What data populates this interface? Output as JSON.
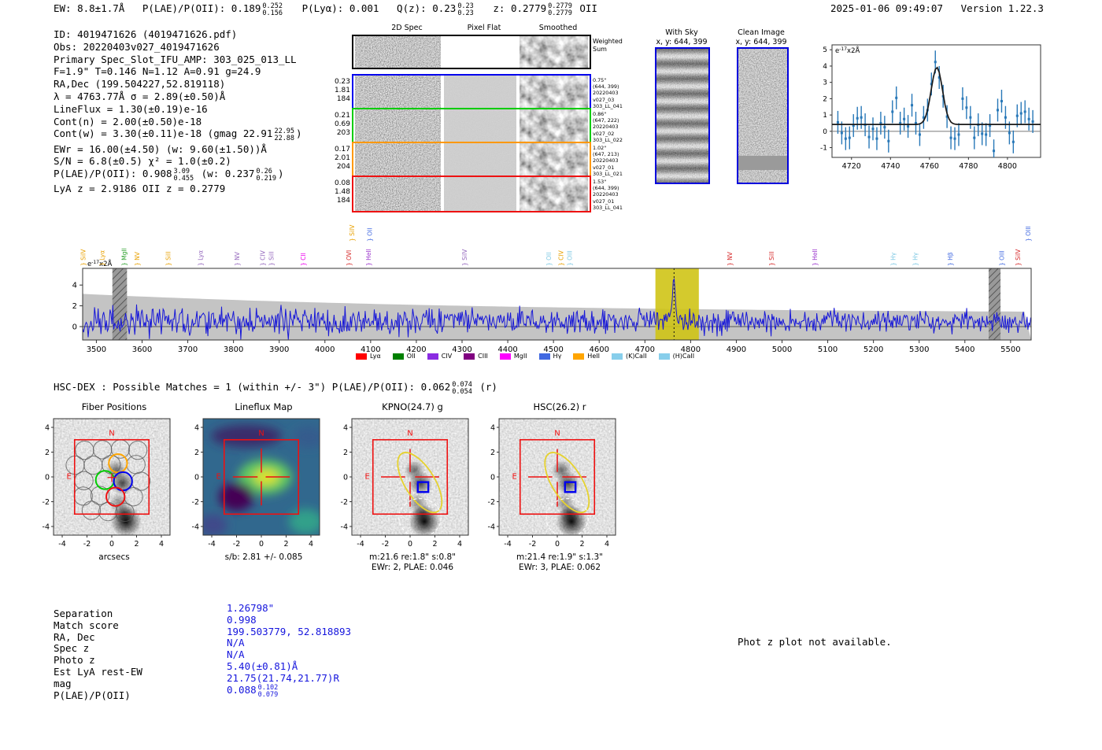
{
  "header": {
    "ew": "EW: 8.8±1.7Å",
    "plae_label": "P(LAE)/P(OII): 0.189",
    "plae_hi": "0.252",
    "plae_lo": "0.156",
    "plya": "P(Lyα): 0.001",
    "qz_label": "Q(z): 0.23",
    "qz_hi": "0.23",
    "qz_lo": "0.23",
    "z_label": "z: 0.2779",
    "z_hi": "0.2779",
    "z_lo": "0.2779",
    "z_suffix": "OII",
    "datetime": "2025-01-06 09:49:07",
    "version": "Version 1.22.3"
  },
  "info": {
    "id": "ID: 4019471626 (4019471626.pdf)",
    "obs": "Obs: 20220403v027_4019471626",
    "slot": "Primary Spec_Slot_IFU_AMP: 303_025_013_LL",
    "seeing": "F=1.9\"  T=0.146  N=1.12  A=0.91  g=24.9",
    "radec": "RA,Dec (199.504227,52.819118)",
    "lambda": "λ = 4763.77Å  σ = 2.89(±0.50)Å",
    "lineflux": "LineFlux = 1.30(±0.19)e-16",
    "cont_n": "Cont(n) = 2.00(±0.50)e-18",
    "cont_w_pre": "Cont(w) = 3.30(±0.11)e-18 (gmag 22.91",
    "cont_w_hi": "22.95",
    "cont_w_lo": "22.88",
    "cont_w_post": ")",
    "ewr": "EWr = 16.00(±4.50) (w: 9.60(±1.50))Å",
    "sn": "S/N = 6.8(±0.5)  χ² = 1.0(±0.2)",
    "plae_pre": "P(LAE)/P(OII): 0.908",
    "plae_hi": "3.09",
    "plae_lo": "0.455",
    "plae_mid": "(w: 0.237",
    "plae_whi": "0.26",
    "plae_wlo": "0.219",
    "plae_post": ")",
    "zline": "LyA z = 2.9186  OII z = 0.2779"
  },
  "spec2d": {
    "col_headers": [
      "2D Spec",
      "Pixel Flat",
      "Smoothed"
    ],
    "rows": [
      {
        "border": "#000000",
        "left": [],
        "right": [
          "Weighted",
          "Sum"
        ],
        "right_big": true
      },
      {
        "border": "#0000ee",
        "left": [
          "0.23",
          "1.81",
          "184"
        ],
        "right": [
          "0.75\"",
          "(644, 399)",
          "20220403",
          "v027_03",
          "303_LL_041"
        ]
      },
      {
        "border": "#00cc00",
        "left": [
          "0.21",
          "0.69",
          "203"
        ],
        "right": [
          "0.86\"",
          "(647, 222)",
          "20220403",
          "v027_02",
          "303_LL_022"
        ]
      },
      {
        "border": "#ff9800",
        "left": [
          "0.17",
          "2.01",
          "204"
        ],
        "right": [
          "1.02\"",
          "(647, 213)",
          "20220403",
          "v027_01",
          "303_LL_021"
        ]
      },
      {
        "border": "#ee1111",
        "left": [
          "0.08",
          "1.48",
          "184"
        ],
        "right": [
          "1.53\"",
          "(644, 399)",
          "20220403",
          "v027_01",
          "303_LL_041"
        ]
      }
    ]
  },
  "stamps": {
    "with_sky_title": "With Sky",
    "with_sky_sub": "x, y: 644, 399",
    "clean_title": "Clean Image",
    "clean_sub": "x, y: 644, 399"
  },
  "hscdex": {
    "pre": "HSC-DEX : Possible Matches = 1 (within +/- 3\")  P(LAE)/P(OII): 0.062",
    "hi": "0.074",
    "lo": "0.054",
    "post": " (r)"
  },
  "chart_data": [
    {
      "type": "scatter",
      "name": "emission-line-fit",
      "units": {
        "base": "e",
        "exp": "-17",
        "rest": "x2Å"
      },
      "xlim": [
        4710,
        4817
      ],
      "xticks": [
        4720,
        4740,
        4760,
        4780,
        4800
      ],
      "ylim": [
        -1.6,
        5.3
      ],
      "yticks": [
        -1,
        0,
        1,
        2,
        3,
        4,
        5
      ],
      "fit_curve": {
        "center": 4763.77,
        "sigma": 2.89,
        "amplitude": 3.5,
        "baseline": 0.42
      },
      "x_start": 4713,
      "x_step": 2,
      "y": [
        0.55,
        -0.1,
        -0.45,
        -0.4,
        0.35,
        0.8,
        0.85,
        0.4,
        -0.35,
        0.15,
        -0.45,
        0.5,
        0.25,
        -0.6,
        1.2,
        2.05,
        0.5,
        0.75,
        0.3,
        1.6,
        0.5,
        -0.2,
        0.85,
        1.3,
        2.9,
        4.25,
        3.3,
        2.15,
        0.9,
        -0.4,
        -0.45,
        -0.2,
        2.0,
        1.45,
        0.85,
        -0.4,
        0.4,
        -0.15,
        -0.2,
        0.35,
        -1.2,
        1.3,
        1.85,
        0.85,
        -0.1,
        -0.65,
        0.95,
        1.1,
        1.2,
        0.75,
        0.6
      ],
      "yerr": 0.7,
      "point_color": "#2878b8",
      "fit_color": "#1a1a1a"
    },
    {
      "type": "line",
      "name": "full-spectrum",
      "units": {
        "base": "e",
        "exp": "-17",
        "rest": "x2Å"
      },
      "xlim": [
        3470,
        5545
      ],
      "xticks": [
        3500,
        3600,
        3700,
        3800,
        3900,
        4000,
        4100,
        4200,
        4300,
        4400,
        4500,
        4600,
        4700,
        4800,
        4900,
        5000,
        5100,
        5200,
        5300,
        5400,
        5500
      ],
      "yticks": [
        0,
        2,
        4
      ],
      "baseline": 0.5,
      "noise_sigma_blue": 1.2,
      "noise_sigma_red": 0.75,
      "emission_fit": {
        "center": 4763.77,
        "amplitude": 4.3,
        "sigma": 3.0
      },
      "masked_regions": [
        [
          3535,
          3567
        ],
        [
          5452,
          5478
        ]
      ],
      "highlight_region": [
        4723,
        4818
      ],
      "marker_line": 4763.77,
      "line_color": "#1818d8",
      "band_color": "#c4c4c4",
      "highlight_color": "#cfc416",
      "line_markers": [
        {
          "wave": 3476,
          "label": "SiIV",
          "color": "#e8a000",
          "row": 1
        },
        {
          "wave": 3517,
          "label": "Lyα",
          "color": "#e8a000",
          "row": 1
        },
        {
          "wave": 3566,
          "label": "MgII",
          "color": "#2ca02c",
          "row": 1
        },
        {
          "wave": 3594,
          "label": "NV",
          "color": "#e8a000",
          "row": 1
        },
        {
          "wave": 3662,
          "label": "SiII",
          "color": "#e8a000",
          "row": 1
        },
        {
          "wave": 3733,
          "label": "Lyα",
          "color": "#9467bd",
          "row": 1
        },
        {
          "wave": 3813,
          "label": "NV",
          "color": "#9467bd",
          "row": 1
        },
        {
          "wave": 3869,
          "label": "CIV",
          "color": "#9467bd",
          "row": 1
        },
        {
          "wave": 3888,
          "label": "SiII",
          "color": "#9467bd",
          "row": 1
        },
        {
          "wave": 3957,
          "label": "CII",
          "color": "#ee00ee",
          "row": 1
        },
        {
          "wave": 4057,
          "label": "OVI",
          "color": "#d62728",
          "row": 1
        },
        {
          "wave": 4064,
          "label": "SiIV",
          "color": "#e8a000",
          "row": 2
        },
        {
          "wave": 4100,
          "label": "HeII",
          "color": "#9932cc",
          "row": 1
        },
        {
          "wave": 4103,
          "label": "OII",
          "color": "#4169e1",
          "row": 2
        },
        {
          "wave": 4310,
          "label": "SiIV",
          "color": "#9467bd",
          "row": 1
        },
        {
          "wave": 4495,
          "label": "OII",
          "color": "#7ec8e3",
          "row": 1
        },
        {
          "wave": 4521,
          "label": "CIV",
          "color": "#e8a000",
          "row": 1
        },
        {
          "wave": 4540,
          "label": "OIII",
          "color": "#7ec8e3",
          "row": 1
        },
        {
          "wave": 4891,
          "label": "NV",
          "color": "#d62728",
          "row": 1
        },
        {
          "wave": 4982,
          "label": "SiII",
          "color": "#d62728",
          "row": 1
        },
        {
          "wave": 5077,
          "label": "HeII",
          "color": "#9932cc",
          "row": 1
        },
        {
          "wave": 5248,
          "label": "Hγ",
          "color": "#7ec8e3",
          "row": 1
        },
        {
          "wave": 5296,
          "label": "Hγ",
          "color": "#7ec8e3",
          "row": 1
        },
        {
          "wave": 5373,
          "label": "Hβ",
          "color": "#4169e1",
          "row": 1
        },
        {
          "wave": 5486,
          "label": "OIII",
          "color": "#4169e1",
          "row": 1
        },
        {
          "wave": 5521,
          "label": "SiIV",
          "color": "#d62728",
          "row": 1
        },
        {
          "wave": 5543,
          "label": "OIII",
          "color": "#4169e1",
          "row": 2
        }
      ],
      "legend": [
        {
          "label": "Lyα",
          "color": "#ff0000"
        },
        {
          "label": "OII",
          "color": "#008000"
        },
        {
          "label": "CIV",
          "color": "#8a2be2"
        },
        {
          "label": "CIII",
          "color": "#800080"
        },
        {
          "label": "MgII",
          "color": "#ff00ff"
        },
        {
          "label": "Hγ",
          "color": "#4169e1"
        },
        {
          "label": "HeII",
          "color": "#ffa500"
        },
        {
          "label": "(K)CaII",
          "color": "#87ceeb"
        },
        {
          "label": "(H)CaII",
          "color": "#87ceeb"
        }
      ]
    }
  ],
  "panels": [
    {
      "id": "fiber",
      "title": "Fiber Positions",
      "xlabel": "arcsecs",
      "compass_n": "N",
      "compass_e": "E"
    },
    {
      "id": "lineflux",
      "title": "Lineflux Map",
      "caption": "s/b: 2.81 +/- 0.085",
      "compass_n": "N",
      "compass_e": "E"
    },
    {
      "id": "kpno",
      "title": "KPNO(24.7) g",
      "caption": "m:21.6  re:1.8\"  s:0.8\"",
      "caption2": "EWr: 2, PLAE: 0.046",
      "compass_n": "N",
      "compass_e": "E"
    },
    {
      "id": "hsc",
      "title": "HSC(26.2) r",
      "caption": "m:21.4  re:1.9\"  s:1.3\"",
      "caption2": "EWr: 3, PLAE: 0.062",
      "compass_n": "N",
      "compass_e": "E"
    }
  ],
  "panel_axis": {
    "ticks": [
      -4,
      -2,
      0,
      2,
      4
    ],
    "range": [
      -4.7,
      4.7
    ]
  },
  "match_table": {
    "rows": [
      {
        "label": "Separation",
        "value": "1.26798\""
      },
      {
        "label": "Match score",
        "value": "0.998"
      },
      {
        "label": "RA, Dec",
        "value": "199.503779, 52.818893"
      },
      {
        "label": "Spec z",
        "value": "N/A"
      },
      {
        "label": "Photo z",
        "value": "N/A"
      },
      {
        "label": "Est LyA rest-EW",
        "value": "5.40(±0.81)Å"
      },
      {
        "label": "mag",
        "value": "21.75(21.74,21.77)R"
      },
      {
        "label": "P(LAE)/P(OII)",
        "value": "0.088",
        "hi": "0.102",
        "lo": "0.079"
      }
    ]
  },
  "photz_note": "Phot z plot not available."
}
